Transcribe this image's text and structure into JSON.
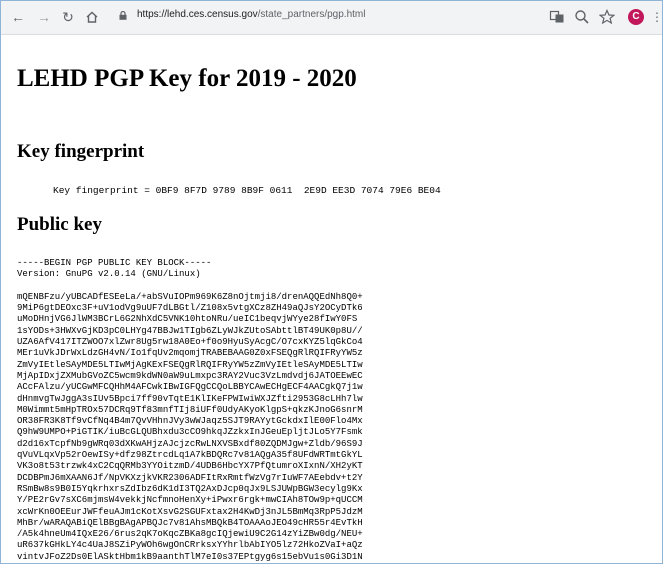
{
  "browser": {
    "url_host": "https://lehd.ces.census.gov",
    "url_path": "/state_partners/pgp.html",
    "avatar_letter": "C",
    "icons": [
      "back-arrow-icon",
      "forward-arrow-icon",
      "reload-icon",
      "home-icon",
      "lock-icon",
      "translate-icon",
      "zoom-icon",
      "star-icon",
      "profile-avatar",
      "kebab-menu-icon"
    ]
  },
  "page": {
    "title": "LEHD PGP Key for 2019 - 2020",
    "fingerprint_heading": "Key fingerprint",
    "fingerprint_line": "Key fingerprint = 0BF9 8F7D 9789 8B9F 0611  2E9D EE3D 7074 79E6 BE04",
    "public_key_heading": "Public key",
    "key_header": "-----BEGIN PGP PUBLIC KEY BLOCK-----",
    "key_version": "Version: GnuPG v2.0.14 (GNU/Linux)",
    "key_lines": [
      "mQENBFzu/yUBCADfESEeLa/+abSVuIOPm969K6Z8nOjtmji8/drenAQQEdNh8Q0+",
      "9MiP6gtDEOxc3F+uV1odVg9uUF7dLBGtl/Z108x5vtgXCz8ZH49aQJsY2OCyDTk6",
      "uMoDHnjVG6JlWM3BCrL6G2NhXdC5VNK10htoNRu/ueIC1beqvjWYye28fIwY0FS",
      "1sYODs+3HWXvGjKD3pC0LHYg47BBJw1TIgb6ZLyWJkZUtoSAbttlBT49UK0p8U//",
      "UZA6AfV417ITZWOO7xlZwr8Ug5rw18A0Eo+f0o9HyuSyAcgC/O7cxKYZ5lqGkCo4",
      "MEr1uVkJDrWxLdzGH4vN/Io1fqUv2mqomjTRABEBAAG0Z0xFSEQgRlRQIFRyYW5z",
      "ZmVyIEtleSAyMDE5LTIwMjAgKExFSEQgRlRQIFRyYW5zZmVyIEtleSAyMDE5LTIw",
      "MjApIDxjZXMubGVoZC5wcm9kdWN0aW9uLmxpc3RAY2Vuc3VzLmdvdj6JATOEEwEC",
      "ACcFAlzu/yUCGwMFCQHhM4AFCwkIBwIGFQgCCQoLBBYCAwECHgECF4AACgkQ7j1w",
      "dHnmvgTwJggA3sIUv5Bpci7ff90vTqtE1KlIKeFPWIwiWXJZfti2953G8cLHh7lw",
      "M0Wimmt5mHpTROx57DCRq9Tf83mnfTIj8iUFf0UdyAKyoKlgpS+qkzKJnoG6snrM",
      "OR38FR3K8Tf9vCfNq4B4m7QvVHhnJVy3wWJaqz5SJT9RAYytGckdxIlE00Flo4Mx",
      "Q9hW9UMPO+PiGTIK/iuBcGLQUBhxdu3cCO9hkqJZzkxInJGeuEpljtJLo5Y7Fsmk",
      "d2d16xTcpfNb9gWRq03dXKwAHjzAJcjzcRwLNXVSBxdf80ZQDMJgw+Zldb/96S9J",
      "qVuVLqxVp52rOewISy+dfz98ZtrcdLq1A7kBDQRc7v81AQgA35f8UFdWRTmtGkYL",
      "VK3o8t53trzwk4xC2CqQRMb3YYOitzmD/4UDB6HbcYX7PfQtumroXIxnN/XH2yKT",
      "DCDBPmJ6mXAAN6Jf/NpVKXzjkVKR2306ADFItRxRmtfWzVg7rIuWF7AEebdv+t2Y",
      "RSmBw8s9B0I5YqkrhxrsZdIbz6dK1dI3TQ2AxDJcp0qJx9LSJUWpBGW3ecylg9Kx",
      "Y/PE2rGv7sXC6mjmsW4vekkjNcfmnoHenXy+iPwxr6rgk+mwCIAh8TOw9p+qUCCM",
      "xcWrKn0OEEurJWFfeuAJm1cKotXsvG2SGUFxtax2H4KwDj3nJL5BmMq3RpP5JdzM",
      "MhBr/wARAQABiQElBBgBAgAPBQJc7v81AhsMBQkB4TOAAAoJEO49cHR55r4EvTkH",
      "/A5k4hneUm4IQxE26/6rus2qK7oKqcZBKa8gcIQjewiU9C2G14zYiZBw0dg/NEU+",
      "uR637kGHkLY4c4UaJ8SZiPyWOh6wgOnCRrksxYYhrlbAbIYO5lz72HkoZVaI+aQz",
      "vintvJFoZ2Ds0ElASktHbm1kB9aanthTlM7eI0s37EPtgyg6s15ebVu1s0Gi3D1N"
    ]
  }
}
